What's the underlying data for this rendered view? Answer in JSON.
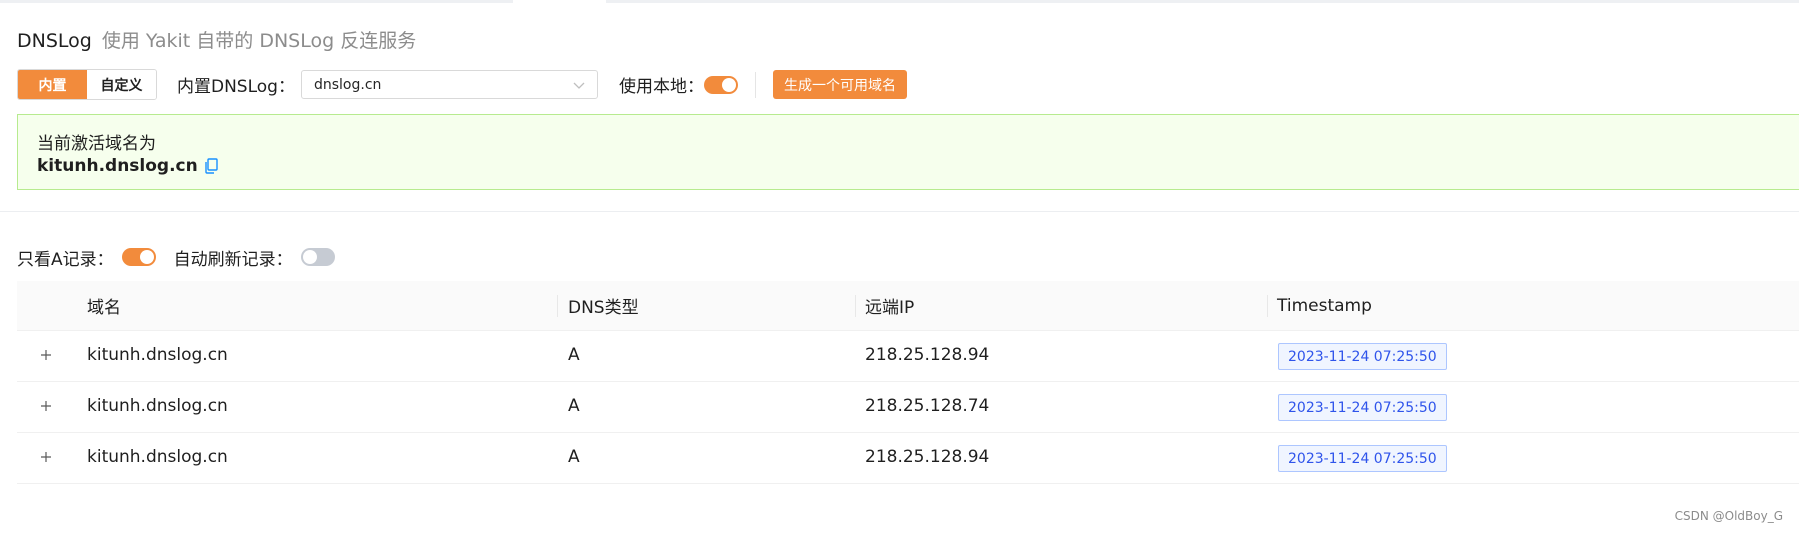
{
  "header": {
    "title": "DNSLog",
    "subtitle": "使用 Yakit 自带的 DNSLog 反连服务"
  },
  "mode_switch": {
    "options": [
      "内置",
      "自定义"
    ],
    "selected": "内置"
  },
  "builtin_dnslog": {
    "label": "内置DNSLog：",
    "value": "dnslog.cn"
  },
  "use_local": {
    "label": "使用本地：",
    "enabled": true
  },
  "generate_button": {
    "label": "生成一个可用域名"
  },
  "alert": {
    "message": "当前激活域名为",
    "domain": "kitunh.dnslog.cn"
  },
  "filters": {
    "only_a_label": "只看A记录：",
    "only_a_enabled": true,
    "auto_refresh_label": "自动刷新记录：",
    "auto_refresh_enabled": false
  },
  "table": {
    "columns": [
      "域名",
      "DNS类型",
      "远端IP",
      "Timestamp"
    ],
    "rows": [
      {
        "domain": "kitunh.dnslog.cn",
        "type": "A",
        "ip": "218.25.128.94",
        "timestamp": "2023-11-24 07:25:50"
      },
      {
        "domain": "kitunh.dnslog.cn",
        "type": "A",
        "ip": "218.25.128.74",
        "timestamp": "2023-11-24 07:25:50"
      },
      {
        "domain": "kitunh.dnslog.cn",
        "type": "A",
        "ip": "218.25.128.94",
        "timestamp": "2023-11-24 07:25:50"
      }
    ]
  },
  "watermark": "CSDN @OldBoy_G",
  "colors": {
    "accent": "#f28b3c",
    "success_bg": "#f6ffed",
    "success_border": "#b7eb8f",
    "tag_text": "#2f54eb",
    "tag_bg": "#f0f5ff",
    "link_blue": "#1890ff"
  }
}
